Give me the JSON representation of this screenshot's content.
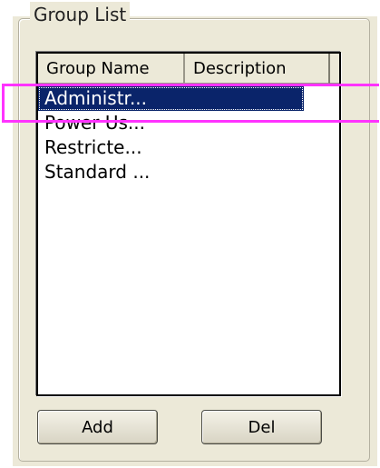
{
  "group_list": {
    "legend": "Group List",
    "columns": [
      "Group Name",
      "Description"
    ],
    "rows": [
      {
        "name": "Administr...",
        "description": "",
        "selected": true
      },
      {
        "name": "Power Us...",
        "description": "",
        "selected": false
      },
      {
        "name": "Restricte...",
        "description": "",
        "selected": false
      },
      {
        "name": "Standard ...",
        "description": "",
        "selected": false
      }
    ]
  },
  "buttons": {
    "add_label": "Add",
    "del_label": "Del"
  },
  "colors": {
    "selection": "#0a246a",
    "highlight_annotation": "#ff33ff",
    "panel_background": "#ece9d8"
  }
}
